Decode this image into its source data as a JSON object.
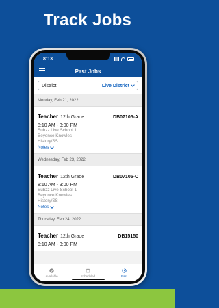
{
  "headline": "Track Jobs",
  "status_bar": {
    "time": "8:13"
  },
  "header": {
    "title": "Past Jobs"
  },
  "filter": {
    "label": "District",
    "value": "Live District"
  },
  "groups": [
    {
      "date": "Monday, Feb 21, 2022",
      "job": {
        "title": "Teacher",
        "grade": "12th Grade",
        "id": "DB07105-A",
        "time": "8:10 AM - 3:00 PM",
        "school": "Subzz Live School 1",
        "person": "Beyonce Knowles",
        "subject": "History/SS",
        "notes": "Notes"
      }
    },
    {
      "date": "Wednesday, Feb 23, 2022",
      "job": {
        "title": "Teacher",
        "grade": "12th Grade",
        "id": "DB07105-C",
        "time": "8:10 AM - 3:00 PM",
        "school": "Subzz Live School 1",
        "person": "Beyonce Knowles",
        "subject": "History/SS",
        "notes": "Notes"
      }
    },
    {
      "date": "Thursday, Feb 24, 2022",
      "job": {
        "title": "Teacher",
        "grade": "12th Grade",
        "id": "DB15150",
        "time": "8:10 AM - 3:00 PM"
      }
    }
  ],
  "nav": [
    {
      "label": "Available",
      "icon": "check-circle-icon"
    },
    {
      "label": "Scheduled",
      "icon": "calendar-icon"
    },
    {
      "label": "Past",
      "icon": "history-icon",
      "active": true
    }
  ],
  "colors": {
    "brand_blue": "#0d4f9a",
    "accent_blue": "#1565c0",
    "accent_green": "#8cc63f"
  }
}
